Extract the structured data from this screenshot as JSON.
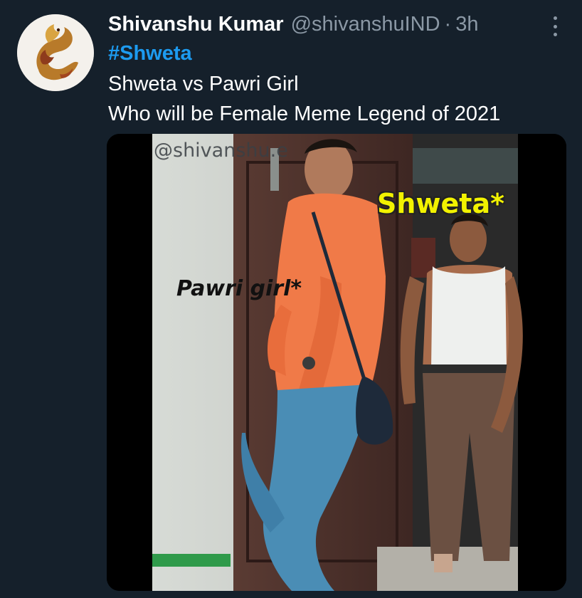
{
  "tweet": {
    "author_name": "Shivanshu Kumar",
    "author_handle": "@shivanshuIND",
    "separator": "·",
    "time": "3h",
    "hashtag": "#Shweta",
    "text_line1": "Shweta vs Pawri Girl",
    "text_line2": "Who will be Female Meme Legend of 2021"
  },
  "media": {
    "watermark": "@shivanshu.e",
    "caption_right": "Shweta*",
    "caption_left": "Pawri girl*"
  },
  "icons": {
    "avatar": "dragon-logo-icon",
    "more": "more-options-icon"
  },
  "colors": {
    "background": "#15202b",
    "hashtag": "#1d9bf0",
    "muted": "#8b98a5",
    "caption_yellow": "#f2f200"
  }
}
